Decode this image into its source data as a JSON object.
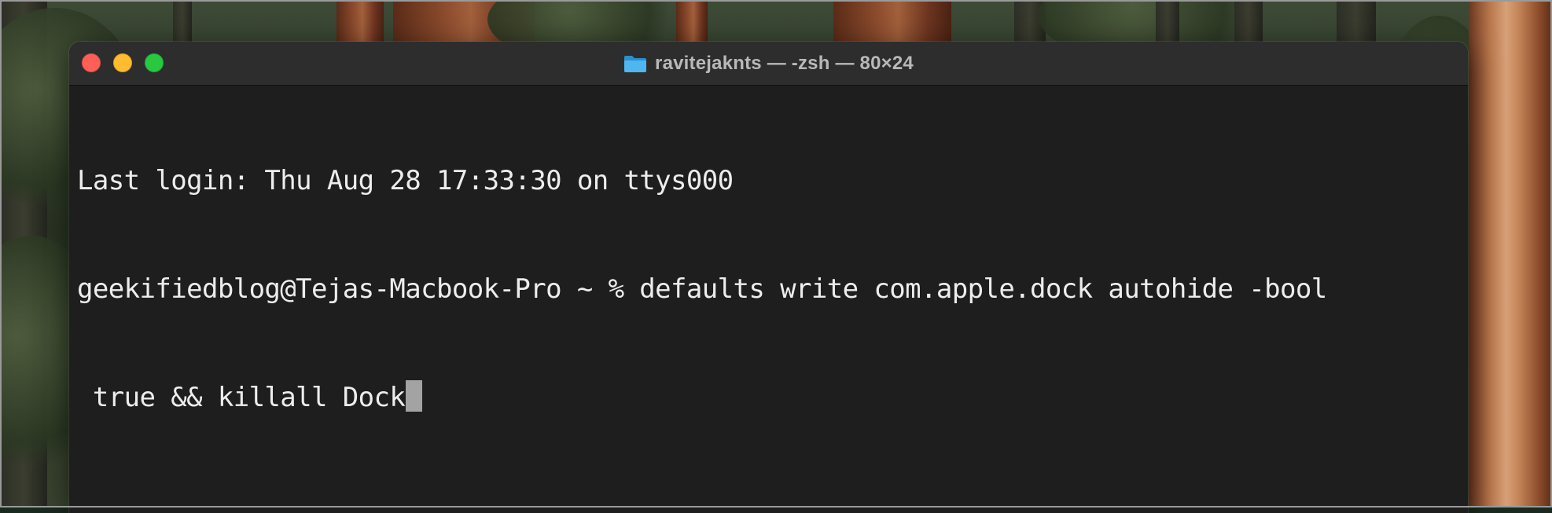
{
  "window": {
    "title": "ravitejaknts — -zsh — 80×24"
  },
  "terminal": {
    "lines": [
      "Last login: Thu Aug 28 17:33:30 on ttys000",
      "geekifiedblog@Tejas-Macbook-Pro ~ % defaults write com.apple.dock autohide -bool",
      " true && killall Dock"
    ]
  },
  "icons": {
    "title_icon": "folder-icon",
    "close": "close-icon",
    "minimize": "minimize-icon",
    "zoom": "zoom-icon"
  },
  "colors": {
    "terminal_bg": "#1e1e1e",
    "titlebar_bg": "#2d2d2d",
    "text": "#ededed",
    "cursor": "#a3a3a3",
    "close": "#ff5f57",
    "minimize": "#febc2e",
    "zoom": "#28c840",
    "folder": "#35a7e8"
  }
}
